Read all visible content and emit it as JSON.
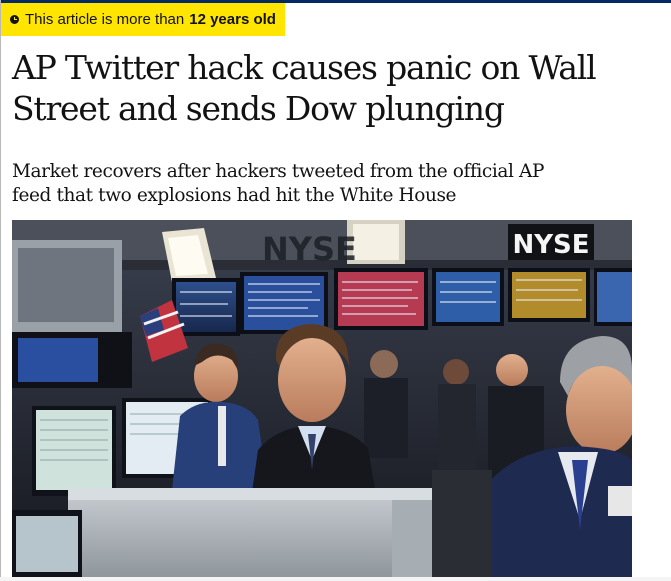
{
  "age_warning": {
    "prefix": "This article is more than",
    "age": "12 years old",
    "icon": "clock-icon",
    "background": "#ffe500"
  },
  "article": {
    "headline": "AP Twitter hack causes panic on Wall Street and sends Dow plunging",
    "standfirst": "Market recovers after hackers tweeted from the official AP feed that two explosions had hit the White House"
  },
  "photo": {
    "sign_text": "NYSE",
    "dark_sign_text": "NYSE"
  },
  "colors": {
    "brand_top_rule": "#052962",
    "text": "#121212"
  }
}
